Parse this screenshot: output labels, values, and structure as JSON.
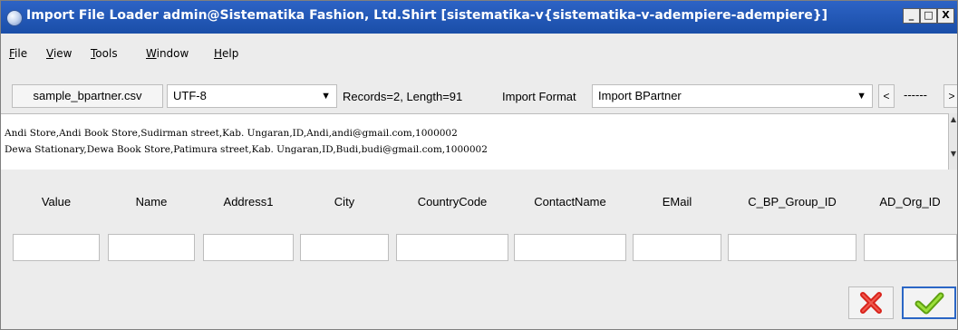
{
  "window": {
    "title": "Import File Loader  admin@Sistematika Fashion, Ltd.Shirt [sistematika-v{sistematika-v-adempiere-adempiere}]",
    "controls": {
      "minimize": "_",
      "maximize": "□",
      "close": "X"
    }
  },
  "menu": [
    {
      "label_first": "F",
      "label_rest": "ile"
    },
    {
      "label_first": "V",
      "label_rest": "iew"
    },
    {
      "label_first": "T",
      "label_rest": "ools"
    },
    {
      "label_first": "W",
      "label_rest": "indow"
    },
    {
      "label_first": "H",
      "label_rest": "elp"
    }
  ],
  "toolbar": {
    "file_button": "sample_bpartner.csv",
    "charset": "UTF-8",
    "records_info": "Records=2, Length=91",
    "import_format_label": "Import Format",
    "import_format_value": "Import BPartner",
    "prev_button": "<",
    "record_indicator": "------",
    "next_button": ">"
  },
  "preview": {
    "lines": [
      "Andi Store,Andi Book Store,Sudirman street,Kab. Ungaran,ID,Andi,andi@gmail.com,1000002",
      "Dewa Stationary,Dewa Book Store,Patimura street,Kab. Ungaran,ID,Budi,budi@gmail.com,1000002"
    ]
  },
  "fields": {
    "columns": [
      "Value",
      "Name",
      "Address1",
      "City",
      "CountryCode",
      "ContactName",
      "EMail",
      "C_BP_Group_ID",
      "AD_Org_ID"
    ]
  },
  "footer": {
    "cancel_icon": "red-x-icon",
    "ok_icon": "green-check-icon"
  },
  "colors": {
    "title_bar": "#1f56b9",
    "cancel": "#d9231b",
    "ok": "#7fc31c",
    "focus_border": "#2a66c5"
  }
}
